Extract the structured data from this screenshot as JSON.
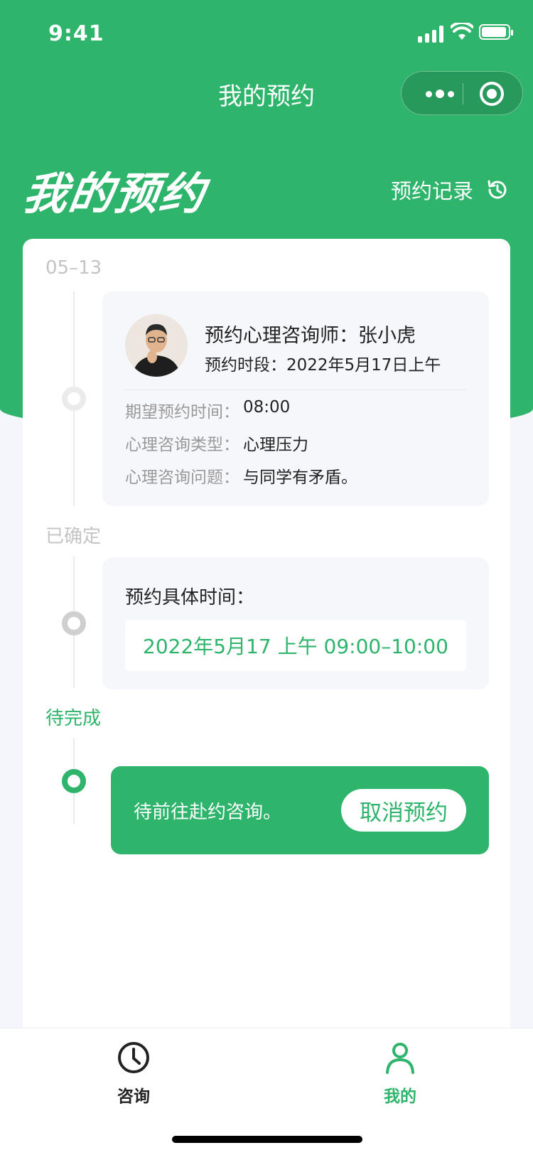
{
  "status_bar": {
    "time": "9:41"
  },
  "nav": {
    "title": "我的预约"
  },
  "header": {
    "big_title": "我的预约",
    "record_label": "预约记录"
  },
  "timeline": {
    "date_label": "05–13",
    "appointment": {
      "counselor": "预约心理咨询师：张小虎",
      "slot": "预约时段：2022年5月17日上午",
      "rows": [
        {
          "key": "期望预约时间：",
          "value": "08:00"
        },
        {
          "key": "心理咨询类型：",
          "value": "心理压力"
        },
        {
          "key": "心理咨询问题：",
          "value": "与同学有矛盾。"
        }
      ]
    },
    "confirmed_label": "已确定",
    "specific_time_label": "预约具体时间：",
    "specific_time_value": "2022年5月17 上午 09:00–10:00",
    "pending_label": "待完成",
    "pending_text": "待前往赴约咨询。",
    "cancel_label": "取消预约"
  },
  "tabs": [
    {
      "label": "咨询",
      "icon": "clock-icon"
    },
    {
      "label": "我的",
      "icon": "person-icon",
      "active": true
    }
  ],
  "colors": {
    "brand_green": "#2eb46b",
    "page_bg": "#f5f6fb"
  }
}
